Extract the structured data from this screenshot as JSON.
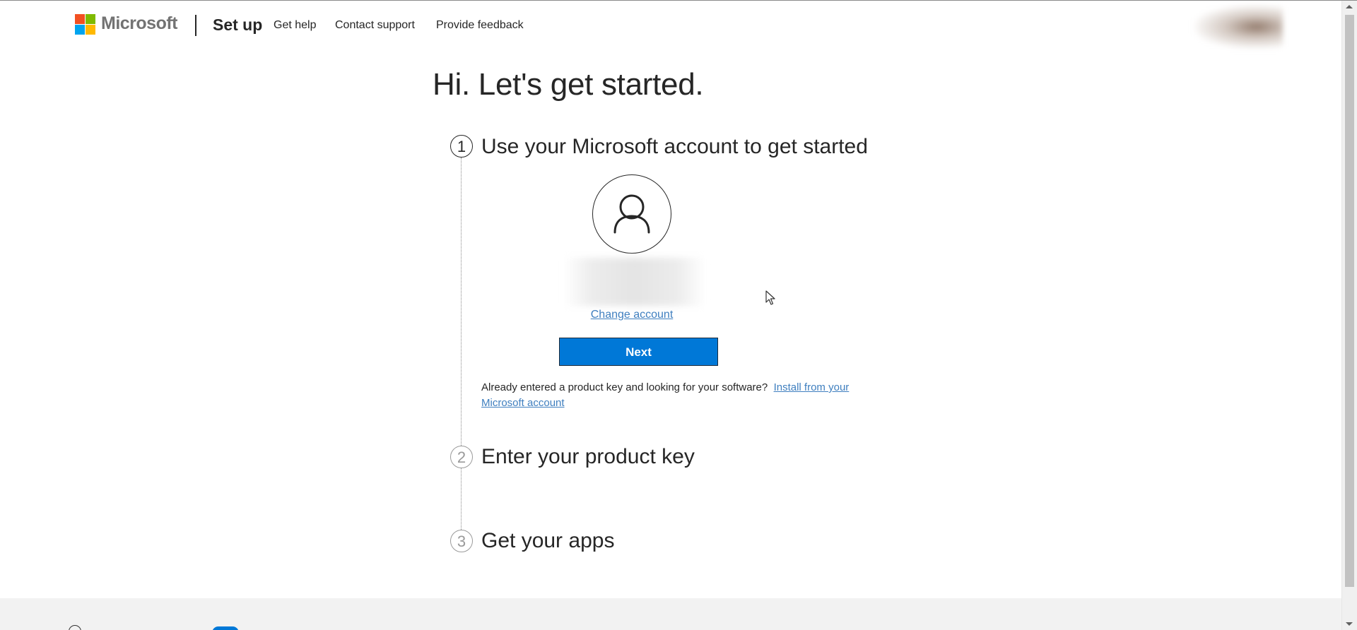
{
  "header": {
    "brand": "Microsoft",
    "title": "Set up",
    "nav": {
      "get_help": "Get help",
      "contact_support": "Contact support",
      "provide_feedback": "Provide feedback"
    }
  },
  "main": {
    "heading": "Hi. Let's get started.",
    "steps": [
      {
        "number": "1",
        "title": "Use your Microsoft account to get started",
        "state": "active"
      },
      {
        "number": "2",
        "title": "Enter your product key",
        "state": "inactive"
      },
      {
        "number": "3",
        "title": "Get your apps",
        "state": "inactive"
      }
    ],
    "account": {
      "change_account": "Change account",
      "next_label": "Next"
    },
    "product_key_note": {
      "text": "Already entered a product key and looking for your software?",
      "link": "Install from your Microsoft account"
    }
  },
  "icons": {
    "logo": "microsoft-logo",
    "avatar": "user-avatar-icon",
    "cursor": "mouse-pointer-icon"
  },
  "colors": {
    "accent": "#0078d7",
    "link": "#3f7fbf",
    "logo_red": "#f25022",
    "logo_green": "#7fba00",
    "logo_blue": "#00a4ef",
    "logo_yellow": "#ffb900"
  }
}
